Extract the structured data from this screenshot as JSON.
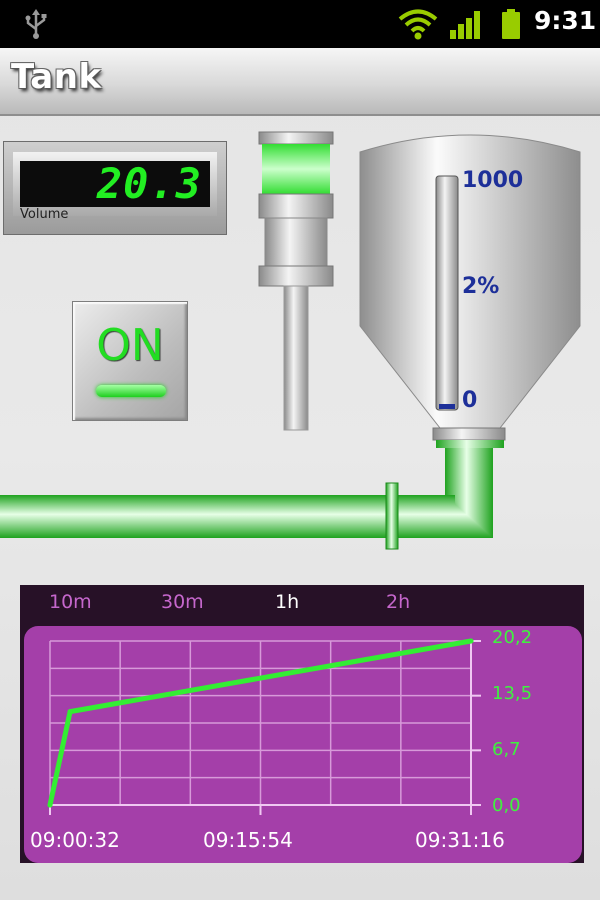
{
  "status_bar": {
    "time": "9:31",
    "icons": [
      "usb-icon",
      "wifi-icon",
      "signal-icon",
      "battery-icon"
    ]
  },
  "title_bar": {
    "title": "Tank"
  },
  "volume_display": {
    "value": "20.3",
    "label": "Volume"
  },
  "power_button": {
    "label": "ON",
    "state": "on"
  },
  "tank": {
    "scale_max": "1000",
    "fill_percent": "2%",
    "scale_min": "0",
    "fill_fraction": 0.02
  },
  "colors": {
    "accent": "#22ee22",
    "pipe_green": "#33dd33",
    "chart_bg": "#a43fa9",
    "chart_frame": "#271127",
    "scale_text": "#1d2f99"
  },
  "chart": {
    "tabs": [
      {
        "label": "10m",
        "selected": false
      },
      {
        "label": "30m",
        "selected": false
      },
      {
        "label": "1h",
        "selected": true
      },
      {
        "label": "2h",
        "selected": false
      }
    ],
    "y_ticks": [
      "20,2",
      "13,5",
      "6,7",
      "0,0"
    ],
    "x_ticks": [
      "09:00:32",
      "09:15:54",
      "09:31:16"
    ]
  },
  "chart_data": {
    "type": "line",
    "title": "",
    "xlabel": "",
    "ylabel": "",
    "x": [
      "09:00:32",
      "09:02:00",
      "09:31:16"
    ],
    "values": [
      0.0,
      11.5,
      20.2
    ],
    "ylim": [
      0,
      20.2
    ],
    "xlim": [
      "09:00:32",
      "09:31:16"
    ],
    "grid": true,
    "legend": "none"
  }
}
